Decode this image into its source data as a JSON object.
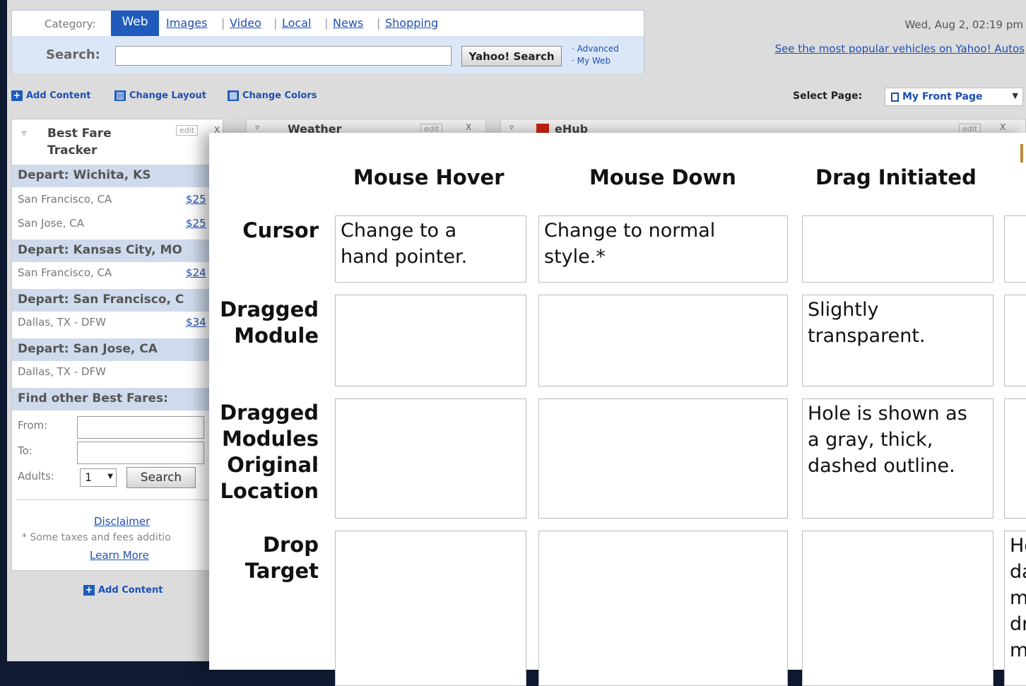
{
  "search": {
    "category_label": "Category:",
    "tabs": [
      "Web",
      "Images",
      "Video",
      "Local",
      "News",
      "Shopping"
    ],
    "search_label": "Search:",
    "search_value": "",
    "button": "Yahoo! Search",
    "advanced": "· Advanced",
    "my_web": "· My Web"
  },
  "header": {
    "datetime": "Wed, Aug 2, 02:19 pm",
    "promo": "See the most popular vehicles on Yahoo! Autos"
  },
  "toolbar": {
    "add_content": "Add Content",
    "change_layout": "Change Layout",
    "change_colors": "Change Colors",
    "select_page_label": "Select Page:",
    "select_page_value": "My Front Page"
  },
  "fare": {
    "title_line1": "Best Fare",
    "title_line2": "Tracker",
    "edit": "edit",
    "close": "X",
    "departs": [
      {
        "label": "Depart: Wichita, KS",
        "rows": [
          {
            "dest": "San Francisco, CA",
            "price": "$25"
          },
          {
            "dest": "San Jose, CA",
            "price": "$25"
          }
        ]
      },
      {
        "label": "Depart: Kansas City, MO",
        "rows": [
          {
            "dest": "San Francisco, CA",
            "price": "$24"
          }
        ]
      },
      {
        "label": "Depart: San Francisco, C",
        "rows": [
          {
            "dest": "Dallas, TX - DFW",
            "price": "$34"
          }
        ]
      },
      {
        "label": "Depart: San Jose, CA",
        "rows": [
          {
            "dest": "Dallas, TX - DFW",
            "price": ""
          }
        ]
      }
    ],
    "find_other": "Find other Best Fares:",
    "from_label": "From:",
    "to_label": "To:",
    "adults_label": "Adults:",
    "adults_value": "1",
    "search_button": "Search",
    "disclaimer": "Disclaimer",
    "tax_note": "* Some taxes and fees additio",
    "learn_more": "Learn More",
    "add_content": "Add Content"
  },
  "bg_modules": {
    "weather": "Weather",
    "edit": "edit",
    "close": "X",
    "third": "eHub"
  },
  "spec_table": {
    "columns": [
      "Mouse Hover",
      "Mouse Down",
      "Drag Initiated"
    ],
    "rows": [
      {
        "header": [
          "Cursor"
        ],
        "cells": [
          [
            "Change to a",
            "hand pointer."
          ],
          [
            "Change to normal",
            "style.*"
          ],
          [],
          []
        ]
      },
      {
        "header": [
          "Dragged",
          "Module"
        ],
        "cells": [
          [],
          [],
          [
            "Slightly",
            "transparent."
          ],
          []
        ]
      },
      {
        "header": [
          "Dragged",
          "Modules",
          "Original",
          "Location"
        ],
        "cells": [
          [],
          [],
          [
            "Hole is shown as",
            "a gray, thick,",
            "dashed outline."
          ],
          []
        ]
      },
      {
        "header": [
          "Drop",
          "Target"
        ],
        "cells": [
          [],
          [],
          [],
          [
            "He",
            "da",
            "m",
            "dr",
            "m"
          ]
        ]
      }
    ]
  }
}
